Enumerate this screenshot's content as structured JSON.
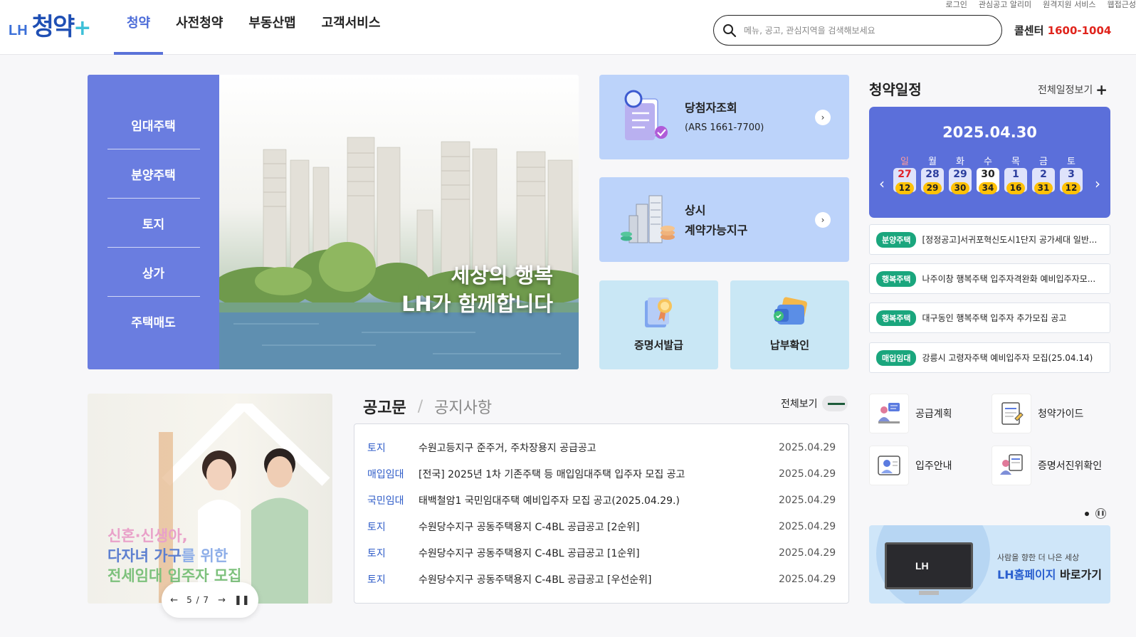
{
  "utility_links": [
    "로그인",
    "관심공고 알리미",
    "원격지원 서비스",
    "웹접근성"
  ],
  "header": {
    "logo_prefix": "LH",
    "logo_main": "청약",
    "logo_plus": "+",
    "nav": [
      "청약",
      "사전청약",
      "부동산맵",
      "고객서비스"
    ],
    "active_nav": "청약",
    "search_placeholder": "메뉴, 공고, 관심지역을 검색해보세요",
    "callcenter_label": "콜센터",
    "callcenter_number": "1600-1004"
  },
  "hero": {
    "menu": [
      "임대주택",
      "분양주택",
      "토지",
      "상가",
      "주택매도"
    ],
    "slogan_line1": "세상의 행복",
    "slogan_line2": "LH가 함께합니다"
  },
  "quick": {
    "winner": {
      "title": "당첨자조회",
      "sub": "(ARS 1661-7700)"
    },
    "contract": {
      "line1": "상시",
      "line2": "계약가능지구"
    },
    "certificate": "증명서발급",
    "payment": "납부확인"
  },
  "schedule": {
    "title": "청약일정",
    "more": "전체일정보기",
    "date": "2025.04.30",
    "weekdays": [
      "일",
      "월",
      "화",
      "수",
      "목",
      "금",
      "토"
    ],
    "days": [
      {
        "day": "27",
        "count": "12"
      },
      {
        "day": "28",
        "count": "29"
      },
      {
        "day": "29",
        "count": "30"
      },
      {
        "day": "30",
        "count": "34"
      },
      {
        "day": "1",
        "count": "16"
      },
      {
        "day": "2",
        "count": "31"
      },
      {
        "day": "3",
        "count": "12"
      }
    ],
    "selected_day": "30",
    "notices": [
      {
        "tag": "분양주택",
        "title": "[정정공고]서귀포혁신도시1단지 공가세대 일반..."
      },
      {
        "tag": "행복주택",
        "title": "나주이창 행복주택 입주자격완화 예비입주자모..."
      },
      {
        "tag": "행복주택",
        "title": "대구동인 행복주택 입주자 추가모집 공고"
      },
      {
        "tag": "매입임대",
        "title": "강릉시 고령자주택 예비입주자 모집(25.04.14)"
      }
    ]
  },
  "services": [
    "공급계획",
    "청약가이드",
    "입주안내",
    "증명서진위확인"
  ],
  "lh_banner": {
    "small": "사람을 향한 더 나은 세상",
    "highlight": "LH홈페이지",
    "rest": " 바로가기"
  },
  "promo": {
    "line1": "신혼·신생아,",
    "line2_a": "다자녀 가구",
    "line2_b": "를 위한",
    "line3": "전세임대 입주자 모집",
    "pager": "5 / 7"
  },
  "announcements": {
    "tab_active": "공고문",
    "tab_other": "공지사항",
    "more": "전체보기",
    "rows": [
      {
        "cat": "토지",
        "title": "수원고등지구 준주거, 주차장용지 공급공고",
        "date": "2025.04.29"
      },
      {
        "cat": "매입임대",
        "title": "[전국] 2025년 1차 기존주택 등 매입임대주택 입주자 모집 공고",
        "date": "2025.04.29"
      },
      {
        "cat": "국민임대",
        "title": "태백철암1 국민임대주택 예비입주자 모집 공고(2025.04.29.)",
        "date": "2025.04.29"
      },
      {
        "cat": "토지",
        "title": "수원당수지구 공동주택용지 C-4BL 공급공고 [2순위]",
        "date": "2025.04.29"
      },
      {
        "cat": "토지",
        "title": "수원당수지구 공동주택용지 C-4BL 공급공고 [1순위]",
        "date": "2025.04.29"
      },
      {
        "cat": "토지",
        "title": "수원당수지구 공동주택용지 C-4BL 공급공고 [우선순위]",
        "date": "2025.04.29"
      }
    ]
  },
  "colors": {
    "brand_blue": "#5b6fda",
    "accent_red": "#e0241c",
    "tag_green": "#1aa67d",
    "badge_yellow": "#ffc107"
  }
}
